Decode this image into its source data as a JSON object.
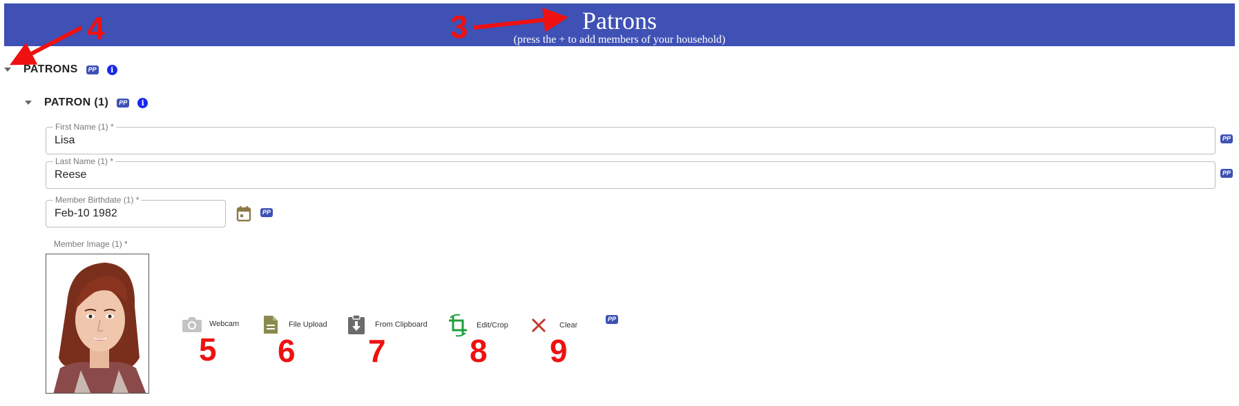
{
  "banner": {
    "title": "Patrons",
    "subtitle": "(press the + to add members of your household)"
  },
  "annotations": [
    "3",
    "4",
    "5",
    "6",
    "7",
    "8",
    "9"
  ],
  "sections": {
    "patrons": {
      "title": "PATRONS",
      "badge": "PP"
    },
    "patron": {
      "title": "PATRON (1)",
      "badge": "PP"
    }
  },
  "fields": {
    "first_name": {
      "label": "First Name (1) *",
      "value": "Lisa",
      "badge": "PP"
    },
    "last_name": {
      "label": "Last Name (1) *",
      "value": "Reese",
      "badge": "PP"
    },
    "birthdate": {
      "label": "Member Birthdate (1) *",
      "value": "Feb-10 1982",
      "badge": "PP"
    }
  },
  "image": {
    "label": "Member Image (1) *",
    "badge": "PP",
    "actions": [
      {
        "label": "Webcam",
        "icon": "camera-icon"
      },
      {
        "label": "File Upload",
        "icon": "file-icon"
      },
      {
        "label": "From Clipboard",
        "icon": "clipboard-download-icon"
      },
      {
        "label": "Edit/Crop",
        "icon": "crop-icon"
      },
      {
        "label": "Clear",
        "icon": "close-icon"
      }
    ]
  },
  "colors": {
    "banner": "#3f51b5",
    "annotation": "#ee1111",
    "info": "#1a28ee",
    "file_icon": "#8a8a50",
    "crop_icon": "#1e9e3a",
    "clear_icon": "#c0392b",
    "calendar_icon": "#8c7a4a"
  }
}
